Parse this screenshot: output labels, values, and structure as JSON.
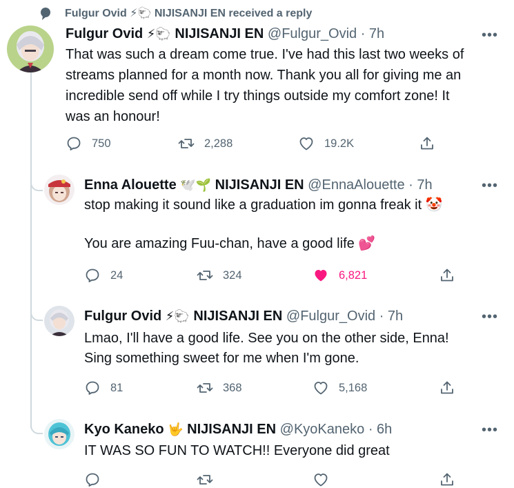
{
  "context": {
    "text": "Fulgur Ovid ⚡🐑 NIJISANJI EN received a reply"
  },
  "tweets": [
    {
      "name": "Fulgur Ovid",
      "emoji": "⚡🐑",
      "org": "NIJISANJI EN",
      "handle": "@Fulgur_Ovid",
      "time": "· 7h",
      "text": "That was such a dream come true. I've had this last two weeks of\nstreams planned for a month now. Thank you all for giving me an\nincredible send off while I try things outside my comfort zone! It\nwas an honour!",
      "replies": "750",
      "retweets": "2,288",
      "likes": "19.2K"
    },
    {
      "name": "Enna Alouette",
      "emoji": "🕊️🌱",
      "org": "NIJISANJI EN",
      "handle": "@EnnaAlouette",
      "time": "· 7h",
      "text": "stop making it sound like a graduation im gonna freak it 🤡\n\nYou are amazing Fuu-chan, have a good life 💕",
      "replies": "24",
      "retweets": "324",
      "likes": "6,821"
    },
    {
      "name": "Fulgur Ovid",
      "emoji": "⚡🐑",
      "org": "NIJISANJI EN",
      "handle": "@Fulgur_Ovid",
      "time": "· 7h",
      "text": "Lmao, I'll have a good life. See you on the other side, Enna!\nSing something sweet for me when I'm gone.",
      "replies": "81",
      "retweets": "368",
      "likes": "5,168"
    },
    {
      "name": "Kyo Kaneko",
      "emoji": "🤟",
      "org": "NIJISANJI EN",
      "handle": "@KyoKaneko",
      "time": "· 6h",
      "text": "IT WAS SO FUN TO WATCH!! Everyone did great"
    }
  ],
  "icons": {
    "context": "speech-bubble-icon",
    "more": "more-options-icon",
    "reply": "reply-icon",
    "retweet": "retweet-icon",
    "like": "like-icon",
    "liked": "liked-heart-icon",
    "share": "share-icon"
  },
  "colors": {
    "text": "#0f1419",
    "secondary": "#536471",
    "thread_line": "#cfd9de",
    "like_active": "#f91880"
  },
  "more_label": "•••"
}
